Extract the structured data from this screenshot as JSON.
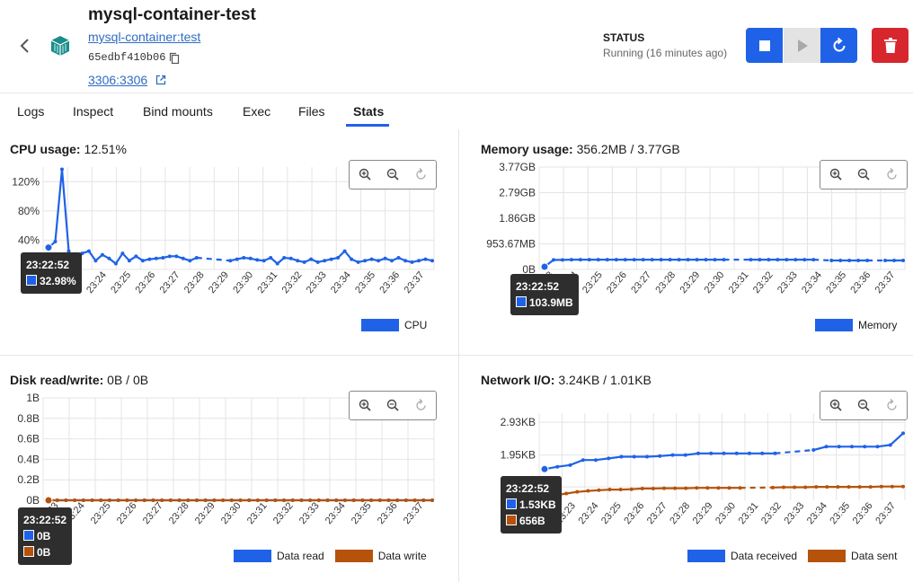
{
  "header": {
    "title": "mysql-container-test",
    "image_link": "mysql-container:test",
    "container_id": "65edbf410b06",
    "port_link": "3306:3306",
    "status_label": "STATUS",
    "status_value": "Running (16 minutes ago)"
  },
  "icons": [
    "chevron-left-icon",
    "container-icon",
    "copy-icon",
    "external-link-icon",
    "stop-icon",
    "play-icon",
    "restart-icon",
    "trash-icon",
    "zoom-in-icon",
    "zoom-out-icon",
    "reset-zoom-icon"
  ],
  "colors": {
    "accent": "#1f62e8",
    "series_blue": "#1f62e8",
    "series_orange": "#b5530b",
    "danger": "#d7262d"
  },
  "tabs": [
    {
      "label": "Logs"
    },
    {
      "label": "Inspect"
    },
    {
      "label": "Bind mounts"
    },
    {
      "label": "Exec"
    },
    {
      "label": "Files"
    },
    {
      "label": "Stats",
      "active": true
    }
  ],
  "panels": {
    "cpu": {
      "label": "CPU usage:",
      "value": "12.51%",
      "tooltip_time": "23:22:52",
      "tooltip_values": [
        "32.98%"
      ],
      "legend": [
        "CPU"
      ]
    },
    "memory": {
      "label": "Memory usage:",
      "value": "356.2MB / 3.77GB",
      "tooltip_time": "23:22:52",
      "tooltip_values": [
        "103.9MB"
      ],
      "legend": [
        "Memory"
      ]
    },
    "disk": {
      "label": "Disk read/write:",
      "value": "0B / 0B",
      "tooltip_time": "23:22:52",
      "tooltip_values": [
        "0B",
        "0B"
      ],
      "legend": [
        "Data read",
        "Data write"
      ]
    },
    "network": {
      "label": "Network I/O:",
      "value": "3.24KB / 1.01KB",
      "tooltip_time": "23:22:52",
      "tooltip_values": [
        "1.53KB",
        "656B"
      ],
      "legend": [
        "Data received",
        "Data sent"
      ]
    }
  },
  "chart_data": [
    {
      "type": "line",
      "id": "cpu",
      "categories": [
        "23:22",
        "23:23",
        "23:24",
        "23:25",
        "23:26",
        "23:27",
        "23:28",
        "23:29",
        "23:30",
        "23:31",
        "23:32",
        "23:33",
        "23:34",
        "23:35",
        "23:36",
        "23:37"
      ],
      "yticks": [
        "0%",
        "40%",
        "80%",
        "120%"
      ],
      "ylim": [
        0,
        140
      ],
      "series": [
        {
          "name": "CPU",
          "color": "#1f62e8",
          "values": [
            30,
            38,
            137,
            25,
            10,
            22,
            25,
            12,
            20,
            15,
            8,
            22,
            12,
            18,
            12,
            14,
            15,
            16,
            18,
            18,
            15,
            12,
            16,
            null,
            null,
            null,
            null,
            12,
            14,
            16,
            15,
            13,
            12,
            16,
            8,
            16,
            15,
            12,
            10,
            14,
            10,
            12,
            14,
            16,
            25,
            14,
            10,
            12,
            14,
            12,
            15,
            12,
            16,
            12,
            10,
            12,
            14,
            12
          ]
        }
      ]
    },
    {
      "type": "line",
      "id": "memory",
      "categories": [
        "23:23",
        "23:24",
        "23:25",
        "23:26",
        "23:27",
        "23:28",
        "23:29",
        "23:30",
        "23:31",
        "23:32",
        "23:33",
        "23:34",
        "23:35",
        "23:36",
        "23:37"
      ],
      "yticks": [
        "0B",
        "953.67MB",
        "1.86GB",
        "2.79GB",
        "3.77GB"
      ],
      "ylim": [
        0,
        3.77
      ],
      "series": [
        {
          "name": "Memory",
          "color": "#1f62e8",
          "values": [
            0.1,
            0.35,
            0.35,
            0.36,
            0.36,
            0.36,
            0.36,
            0.36,
            0.36,
            0.36,
            0.36,
            0.36,
            0.36,
            0.36,
            0.36,
            0.36,
            0.36,
            0.36,
            0.36,
            0.36,
            0.36,
            null,
            null,
            0.36,
            0.36,
            0.36,
            0.36,
            0.36,
            0.36,
            0.36,
            0.36,
            null,
            0.33,
            0.33,
            0.33,
            0.33,
            0.33,
            null,
            0.33,
            0.33,
            0.33
          ]
        }
      ]
    },
    {
      "type": "line",
      "id": "disk",
      "categories": [
        "23:23",
        "23:24",
        "23:25",
        "23:26",
        "23:27",
        "23:28",
        "23:29",
        "23:30",
        "23:31",
        "23:32",
        "23:33",
        "23:34",
        "23:35",
        "23:36",
        "23:37"
      ],
      "yticks": [
        "0B",
        "0.2B",
        "0.4B",
        "0.6B",
        "0.8B",
        "1B"
      ],
      "ylim": [
        0,
        1
      ],
      "series": [
        {
          "name": "Data read",
          "color": "#1f62e8",
          "values": [
            0,
            0,
            0,
            0,
            0,
            0,
            0,
            0,
            0,
            0,
            0,
            0,
            0,
            0,
            0,
            0,
            0,
            0,
            0,
            0,
            0,
            0,
            0,
            0,
            0,
            0,
            0,
            0,
            0,
            0,
            0,
            0,
            0,
            0,
            0,
            0,
            0,
            0,
            0,
            0,
            0,
            0,
            0,
            0,
            0
          ]
        },
        {
          "name": "Data write",
          "color": "#b5530b",
          "values": [
            0,
            0,
            0,
            0,
            0,
            0,
            0,
            0,
            0,
            0,
            0,
            0,
            0,
            0,
            0,
            0,
            0,
            0,
            0,
            0,
            0,
            0,
            0,
            0,
            0,
            0,
            0,
            0,
            0,
            0,
            0,
            0,
            0,
            0,
            0,
            0,
            0,
            0,
            0,
            0,
            0,
            0,
            0,
            0,
            0
          ]
        }
      ]
    },
    {
      "type": "line",
      "id": "network",
      "categories": [
        "23:22",
        "23:23",
        "23:24",
        "23:25",
        "23:26",
        "23:27",
        "23:28",
        "23:29",
        "23:30",
        "23:31",
        "23:32",
        "23:33",
        "23:34",
        "23:35",
        "23:36",
        "23:37"
      ],
      "yticks": [
        "1000B",
        "1.95KB",
        "2.93KB"
      ],
      "ylim": [
        0.6,
        3.2
      ],
      "series": [
        {
          "name": "Data received",
          "color": "#1f62e8",
          "values": [
            1.53,
            1.6,
            1.65,
            1.8,
            1.8,
            1.85,
            1.9,
            1.9,
            1.9,
            1.92,
            1.95,
            1.95,
            2.0,
            2.0,
            2.0,
            2.0,
            2.0,
            2.0,
            2.0,
            null,
            null,
            2.1,
            2.2,
            2.2,
            2.2,
            2.2,
            2.2,
            2.25,
            2.6
          ]
        },
        {
          "name": "Data sent",
          "color": "#b5530b",
          "values": [
            0.65,
            0.75,
            0.8,
            0.85,
            0.88,
            0.9,
            0.92,
            0.92,
            0.93,
            0.95,
            0.95,
            0.96,
            0.96,
            0.96,
            0.97,
            0.97,
            0.97,
            0.97,
            0.97,
            null,
            null,
            0.98,
            0.99,
            0.99,
            0.99,
            1.0,
            1.0,
            1.0,
            1.0,
            1.0,
            1.0,
            1.01,
            1.01,
            1.01
          ]
        }
      ]
    }
  ]
}
